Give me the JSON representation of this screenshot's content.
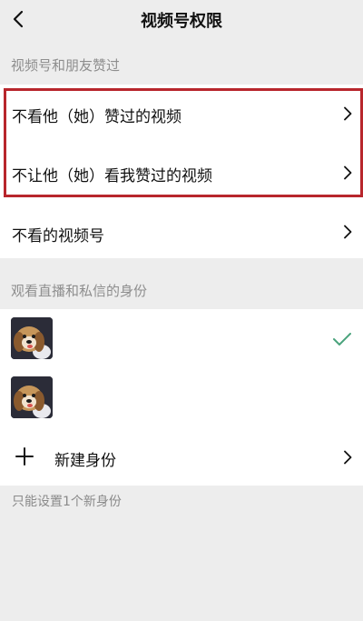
{
  "header": {
    "title": "视频号权限",
    "back_icon": "chevron-left-icon"
  },
  "section_likes": {
    "title": "视频号和朋友赞过",
    "items": [
      {
        "label": "不看他（她）赞过的视频",
        "icon": "chevron-right-icon"
      },
      {
        "label": "不让他（她）看我赞过的视频",
        "icon": "chevron-right-icon"
      },
      {
        "label": "不看的视频号",
        "icon": "chevron-right-icon"
      }
    ]
  },
  "section_identity": {
    "title": "观看直播和私信的身份",
    "identities": [
      {
        "selected": true,
        "avatar": "dog-avatar"
      },
      {
        "selected": false,
        "avatar": "dog-avatar"
      }
    ],
    "new_identity_label": "新建身份",
    "new_identity_icon": "plus-icon"
  },
  "footer_note": "只能设置1个新身份",
  "colors": {
    "highlight": "#b8262c",
    "check": "#4aa37c",
    "background": "#ededed"
  }
}
